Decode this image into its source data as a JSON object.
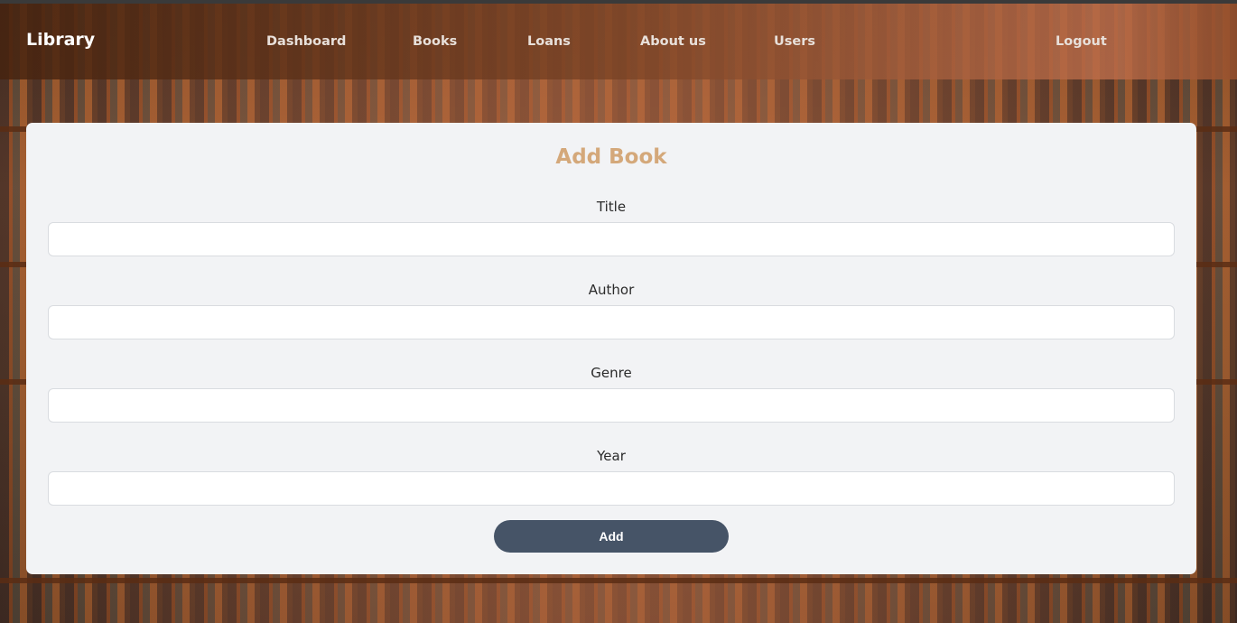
{
  "nav": {
    "brand": "Library",
    "links": {
      "dashboard": "Dashboard",
      "books": "Books",
      "loans": "Loans",
      "about": "About us",
      "users": "Users",
      "logout": "Logout"
    }
  },
  "form": {
    "title": "Add Book",
    "fields": {
      "title": {
        "label": "Title",
        "value": "",
        "placeholder": ""
      },
      "author": {
        "label": "Author",
        "value": "",
        "placeholder": ""
      },
      "genre": {
        "label": "Genre",
        "value": "",
        "placeholder": ""
      },
      "year": {
        "label": "Year",
        "value": "",
        "placeholder": ""
      }
    },
    "submit_label": "Add"
  },
  "colors": {
    "title_accent": "#d4a87a",
    "button": "#465467",
    "card_bg": "#f2f3f5"
  }
}
